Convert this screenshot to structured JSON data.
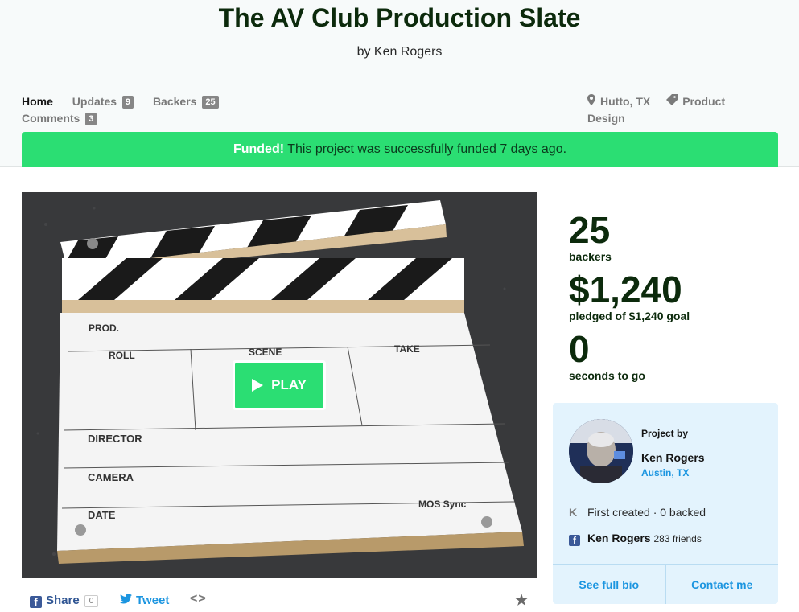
{
  "header": {
    "title": "The AV Club Production Slate",
    "byline": "by Ken Rogers"
  },
  "tabs": [
    {
      "label": "Home"
    },
    {
      "label": "Updates",
      "count": "9"
    },
    {
      "label": "Backers",
      "count": "25"
    },
    {
      "label": "Comments",
      "count": "3"
    }
  ],
  "meta": {
    "location": "Hutto, TX",
    "category": "Product Design",
    "location_icon": "map-pin-icon",
    "category_icon": "tag-icon"
  },
  "funded_banner": {
    "strong": "Funded!",
    "text": "This project was successfully funded 7 days ago."
  },
  "video": {
    "play_label": "PLAY",
    "slate_labels": {
      "prod": "PROD.",
      "roll": "ROLL",
      "scene": "SCENE",
      "take": "TAKE",
      "director": "DIRECTOR",
      "camera": "CAMERA",
      "date": "DATE",
      "mos": "MOS Sync"
    }
  },
  "share": {
    "share_label": "Share",
    "share_count": "0",
    "tweet_label": "Tweet",
    "embed_label": "<>",
    "star_icon": "star-icon"
  },
  "stats": {
    "backers_count": "25",
    "backers_label": "backers",
    "pledged_amount": "$1,240",
    "pledged_label": "pledged of $1,240 goal",
    "time_value": "0",
    "time_label": "seconds to go"
  },
  "creator": {
    "project_by_label": "Project by",
    "name": "Ken Rogers",
    "location": "Austin, TX",
    "history": "First created · 0 backed",
    "fb_name": "Ken Rogers",
    "fb_friends": "283 friends",
    "bio_button": "See full bio",
    "contact_button": "Contact me"
  },
  "colors": {
    "accent_green": "#2bde73",
    "title_green": "#0c2a0c",
    "link_blue": "#1b95e0",
    "creator_bg": "#e3f3fd"
  }
}
